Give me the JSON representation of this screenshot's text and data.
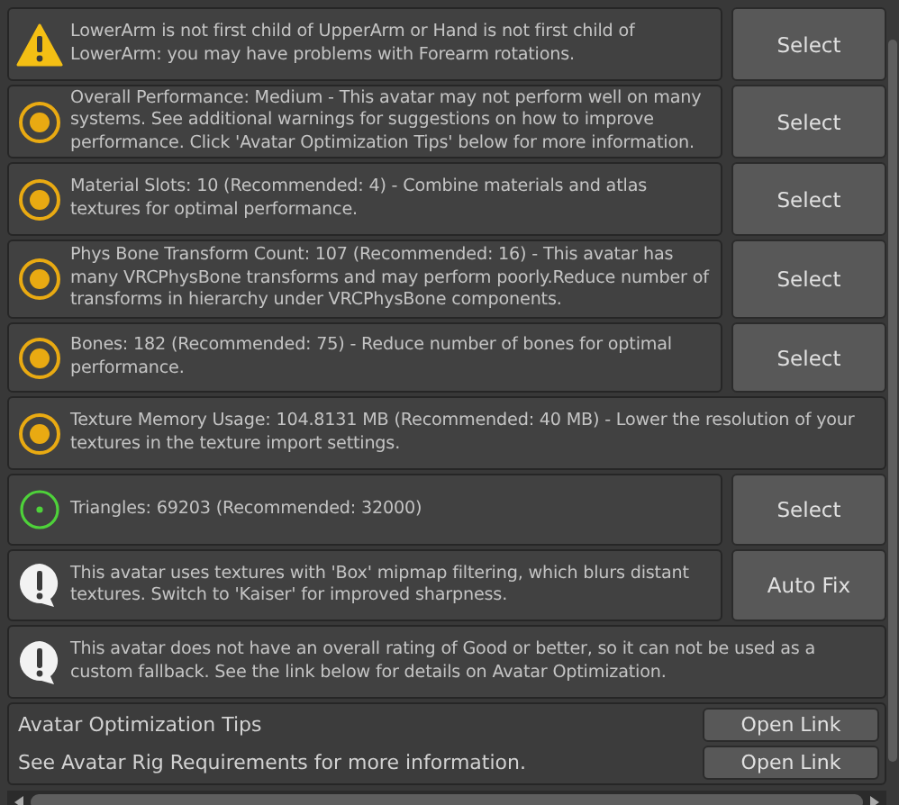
{
  "messages": [
    {
      "kind": "warning",
      "text": "LowerArm is not first child of UpperArm or Hand is not first child of LowerArm: you may have problems with Forearm rotations.",
      "button": "Select"
    },
    {
      "kind": "performance",
      "text": "Overall Performance: Medium - This avatar may not perform well on many systems. See additional warnings for suggestions on how to improve performance. Click 'Avatar Optimization Tips' below for more information.",
      "button": "Select"
    },
    {
      "kind": "performance",
      "text": "Material Slots: 10 (Recommended: 4) - Combine materials and atlas textures for optimal performance.",
      "button": "Select"
    },
    {
      "kind": "performance",
      "text": "Phys Bone Transform Count: 107 (Recommended: 16) - This avatar has many VRCPhysBone transforms and may perform poorly.Reduce number of transforms in hierarchy under VRCPhysBone components.",
      "button": "Select"
    },
    {
      "kind": "performance",
      "text": "Bones: 182 (Recommended: 75) - Reduce number of bones for optimal performance.",
      "button": "Select"
    },
    {
      "kind": "performance",
      "text": "Texture Memory Usage: 104.8131 MB (Recommended: 40 MB) - Lower the resolution of your textures in the texture import settings."
    },
    {
      "kind": "good",
      "text": "Triangles: 69203 (Recommended: 32000)",
      "button": "Select"
    },
    {
      "kind": "info",
      "text": "This avatar uses textures with 'Box' mipmap filtering, which blurs distant textures. Switch to 'Kaiser' for improved sharpness.",
      "button": "Auto Fix"
    },
    {
      "kind": "info",
      "text": "This avatar does not have an overall rating of Good or better, so it can not be used as a custom fallback. See the link below for details on Avatar Optimization."
    }
  ],
  "links": [
    {
      "label": "Avatar Optimization Tips",
      "button": "Open Link"
    },
    {
      "label": "See Avatar Rig Requirements for more information.",
      "button": "Open Link"
    }
  ]
}
